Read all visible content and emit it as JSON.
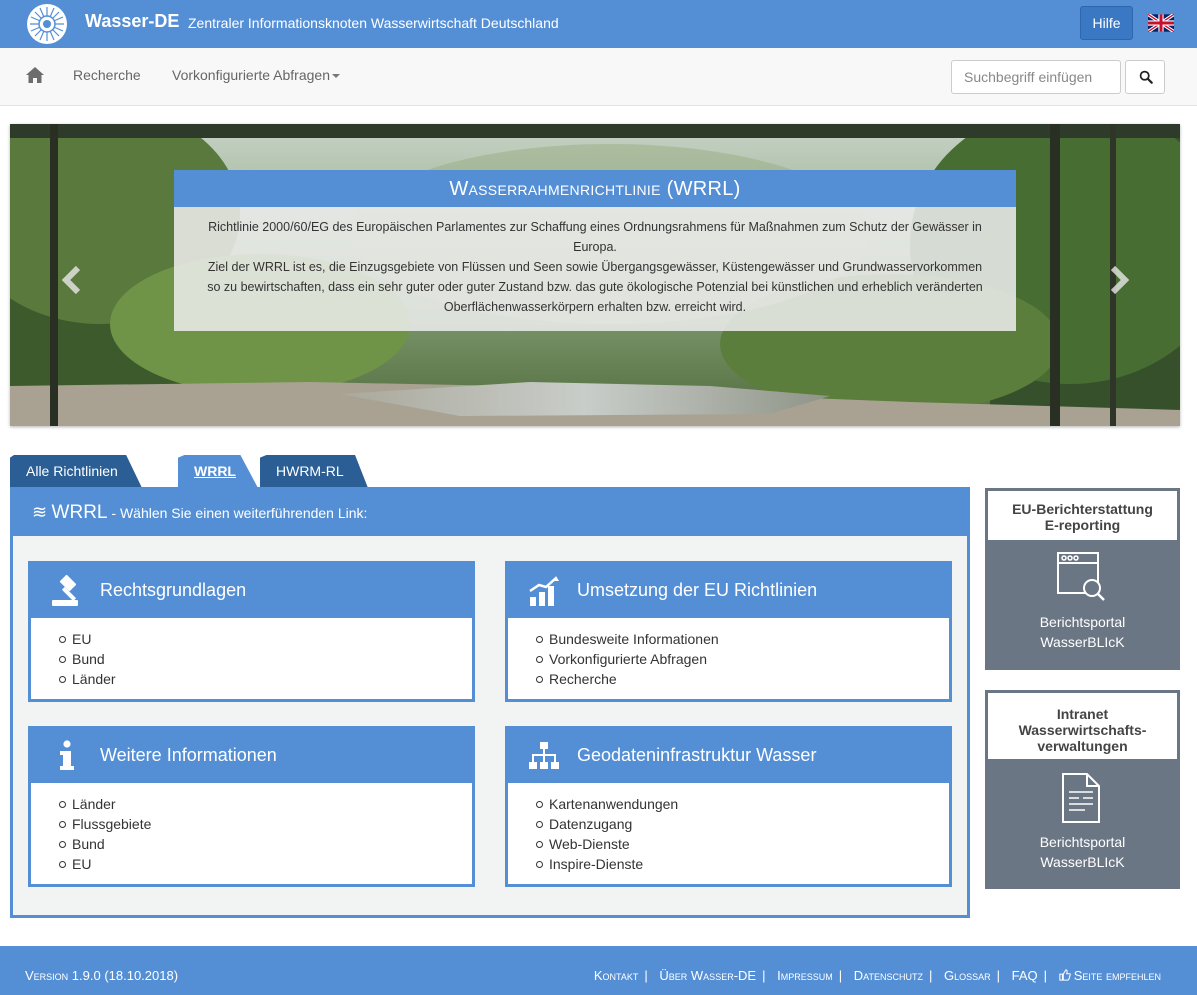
{
  "header": {
    "brand": "Wasser-DE",
    "tagline": "Zentraler Informationsknoten Wasserwirtschaft Deutschland",
    "help": "Hilfe"
  },
  "nav": {
    "recherche": "Recherche",
    "vorkonfiguriert": "Vorkonfigurierte Abfragen",
    "search_placeholder": "Suchbegriff einfügen"
  },
  "hero": {
    "title": "Wasserrahmenrichtlinie (WRRL)",
    "line1": "Richtlinie 2000/60/EG des Europäischen Parlamentes zur Schaffung eines Ordnungsrahmens für Maßnahmen zum Schutz der Gewässer in Europa.",
    "line2": "Ziel der WRRL ist es, die Einzugsgebiete von Flüssen und Seen sowie Übergangsgewässer, Küstengewässer und Grundwasservorkommen so zu bewirtschaften, dass ein sehr guter oder guter Zustand bzw. das gute ökologische Potenzial bei künstlichen und erheblich veränderten Oberflächenwasserkörpern erhalten bzw. erreicht wird."
  },
  "tabs": {
    "all": "Alle Richtlinien",
    "wrrl": "WRRL",
    "hwrm": "HWRM-RL"
  },
  "panel": {
    "symbol": "≋",
    "title": "WRRL",
    "subtitle": " - Wählen Sie einen weiterführenden Link:"
  },
  "cards": [
    {
      "title": "Rechtsgrundlagen",
      "items": [
        "EU",
        "Bund",
        "Länder"
      ]
    },
    {
      "title": "Umsetzung der EU Richtlinien",
      "items": [
        "Bundesweite Informationen",
        "Vorkonfigurierte Abfragen",
        "Recherche"
      ]
    },
    {
      "title": "Weitere Informationen",
      "items": [
        "Länder",
        "Flussgebiete",
        "Bund",
        "EU"
      ]
    },
    {
      "title": "Geodateninfrastruktur Wasser",
      "items": [
        "Kartenanwendungen",
        "Datenzugang",
        "Web-Dienste",
        "Inspire-Dienste"
      ]
    }
  ],
  "side": [
    {
      "head1": "EU-Berichterstattung",
      "head2": "E-reporting",
      "label1": "Berichtsportal",
      "label2": "WasserBLIcK"
    },
    {
      "head1": "Intranet",
      "head2": "Wasserwirtschafts-",
      "head3": "verwaltungen",
      "label1": "Berichtsportal",
      "label2": "WasserBLIcK"
    }
  ],
  "footer": {
    "version": "Version 1.9.0 (18.10.2018)",
    "kontakt": "Kontakt",
    "ueber": "Über Wasser-DE",
    "impressum": "Impressum",
    "datenschutz": "Datenschutz",
    "glossar": "Glossar",
    "faq": "FAQ",
    "empfehlen": "Seite empfehlen"
  },
  "colors": {
    "primary": "#548fd6",
    "dark_tab": "#2a5e95",
    "side_bg": "#6b7685"
  },
  "icons": [
    "logo-icon",
    "uk-flag-icon",
    "home-icon",
    "search-icon",
    "chevron-left-icon",
    "chevron-right-icon",
    "gavel-icon",
    "bar-chart-icon",
    "info-icon",
    "sitemap-icon",
    "browser-search-icon",
    "document-icon",
    "thumbs-up-icon"
  ]
}
